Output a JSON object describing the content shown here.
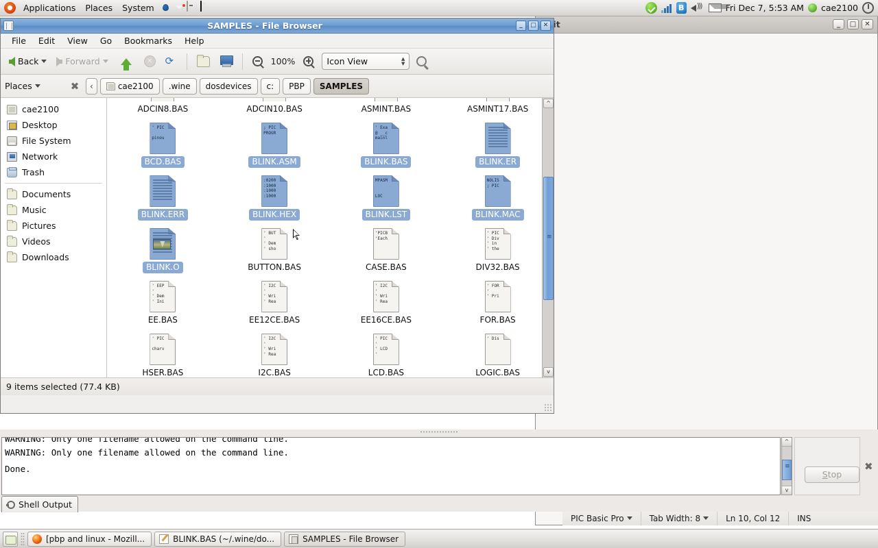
{
  "panel": {
    "menus": [
      "Applications",
      "Places",
      "System"
    ],
    "launchers": [
      "firefox-icon",
      "thunderbird-icon",
      "gamepad-icon",
      "terminal-icon"
    ],
    "tray": [
      "update-ok-icon",
      "network-signal-icon",
      "bluetooth-icon",
      "volume-icon",
      "mail-icon"
    ],
    "clock": "Fri Dec  7,  5:53 AM",
    "user": "cae2100",
    "power_icon": "power-icon"
  },
  "background_window": {
    "title": "edit",
    "buttons": [
      "_",
      "□",
      "✕"
    ],
    "statusbar": {
      "language": "PIC Basic Pro",
      "tab_width": "Tab Width:  8",
      "position": "Ln 10, Col 12",
      "mode": "INS"
    }
  },
  "file_browser": {
    "title": "SAMPLES - File Browser",
    "title_buttons": [
      "_",
      "□",
      "✕"
    ],
    "menu": [
      "File",
      "Edit",
      "View",
      "Go",
      "Bookmarks",
      "Help"
    ],
    "toolbar": {
      "back": "Back",
      "forward": "Forward",
      "zoom_level": "100%",
      "view_mode": "Icon View"
    },
    "pathbar": {
      "places_label": "Places",
      "crumbs": [
        "cae2100",
        ".wine",
        "dosdevices",
        "c:",
        "PBP",
        "SAMPLES"
      ],
      "current": "SAMPLES"
    },
    "sidebar": {
      "group1": [
        {
          "label": "cae2100",
          "icon": "home-folder-icon"
        },
        {
          "label": "Desktop",
          "icon": "desktop-icon"
        },
        {
          "label": "File System",
          "icon": "filesystem-icon"
        },
        {
          "label": "Network",
          "icon": "network-icon"
        },
        {
          "label": "Trash",
          "icon": "trash-icon"
        }
      ],
      "group2": [
        {
          "label": "Documents",
          "icon": "folder-icon"
        },
        {
          "label": "Music",
          "icon": "folder-icon"
        },
        {
          "label": "Pictures",
          "icon": "folder-icon"
        },
        {
          "label": "Videos",
          "icon": "folder-icon"
        },
        {
          "label": "Downloads",
          "icon": "folder-icon"
        }
      ]
    },
    "files": [
      {
        "name": "ADCIN8.BAS",
        "selected": false,
        "kind": "clipped",
        "preview": ""
      },
      {
        "name": "ADCIN10.BAS",
        "selected": false,
        "kind": "clipped",
        "preview": ""
      },
      {
        "name": "ASMINT.BAS",
        "selected": false,
        "kind": "clipped",
        "preview": ""
      },
      {
        "name": "ASMINT17.BAS",
        "selected": false,
        "kind": "clipped",
        "preview": ""
      },
      {
        "name": "BCD.BAS",
        "selected": true,
        "kind": "text",
        "preview": "' PIC\n\npinou"
      },
      {
        "name": "BLINK.ASM",
        "selected": true,
        "kind": "text",
        "preview": "; PIC\nPROGR"
      },
      {
        "name": "BLINK.BAS",
        "selected": true,
        "kind": "text",
        "preview": "' Exa\n@ __c\nmainl"
      },
      {
        "name": "BLINK.ER",
        "selected": true,
        "kind": "lines",
        "preview": ""
      },
      {
        "name": "BLINK.ERR",
        "selected": true,
        "kind": "lines",
        "preview": ""
      },
      {
        "name": "BLINK.HEX",
        "selected": true,
        "kind": "text",
        "preview": ":0200\n:1000\n:1000\n:1000"
      },
      {
        "name": "BLINK.LST",
        "selected": true,
        "kind": "text",
        "preview": "MPASM\n\n\nLOC"
      },
      {
        "name": "BLINK.MAC",
        "selected": true,
        "kind": "text",
        "preview": "NOLIS\n; PIC"
      },
      {
        "name": "BLINK.O",
        "selected": true,
        "kind": "image",
        "preview": ""
      },
      {
        "name": "BUTTON.BAS",
        "selected": false,
        "kind": "text",
        "preview": "' BUT\n'\n' Dem\n' sho"
      },
      {
        "name": "CASE.BAS",
        "selected": false,
        "kind": "text",
        "preview": "'PICB\n'Each"
      },
      {
        "name": "DIV32.BAS",
        "selected": false,
        "kind": "text",
        "preview": "' PIC\n' Div\n' in\n' the"
      },
      {
        "name": "EE.BAS",
        "selected": false,
        "kind": "text",
        "preview": "' EEP\n'\n' Dem\n' Ini"
      },
      {
        "name": "EE12CE.BAS",
        "selected": false,
        "kind": "text",
        "preview": "' I2C\n'\n' Wri\n' Rea"
      },
      {
        "name": "EE16CE.BAS",
        "selected": false,
        "kind": "text",
        "preview": "' I2C\n'\n' Wri\n' Rea"
      },
      {
        "name": "FOR.BAS",
        "selected": false,
        "kind": "text",
        "preview": "' FOR\n'\n' Pri"
      },
      {
        "name": "HSER.BAS",
        "selected": false,
        "kind": "text",
        "preview": "' PIC\n\ncharv"
      },
      {
        "name": "I2C.BAS",
        "selected": false,
        "kind": "text",
        "preview": "' I2C\n'\n' Wri\n' Rea"
      },
      {
        "name": "LCD.BAS",
        "selected": false,
        "kind": "text",
        "preview": "' PIC\n'\n' LCD\n'"
      },
      {
        "name": "LOGIC.BAS",
        "selected": false,
        "kind": "text",
        "preview": "' Dis"
      }
    ],
    "status": "9 items selected (77.4 KB)"
  },
  "shell_dock": {
    "lines": [
      "WARNING: Only one filename allowed on the command line.",
      "WARNING: Only one filename allowed on the command line.",
      "",
      "Done."
    ],
    "stop_button": "Stop",
    "tab_label": "Shell Output",
    "close_icon": "close-icon"
  },
  "taskbar": {
    "items": [
      {
        "label": "[pbp and linux - Mozill...",
        "icon": "firefox-icon",
        "active": false
      },
      {
        "label": "BLINK.BAS (~/.wine/do...",
        "icon": "editor-icon",
        "active": false
      },
      {
        "label": "SAMPLES - File Browser",
        "icon": "filebrowser-icon",
        "active": true
      }
    ]
  },
  "colors": {
    "selection_blue": "#8aaad4",
    "title_blue": "#6e9ed2",
    "panel_grey": "#e4e2e0"
  }
}
